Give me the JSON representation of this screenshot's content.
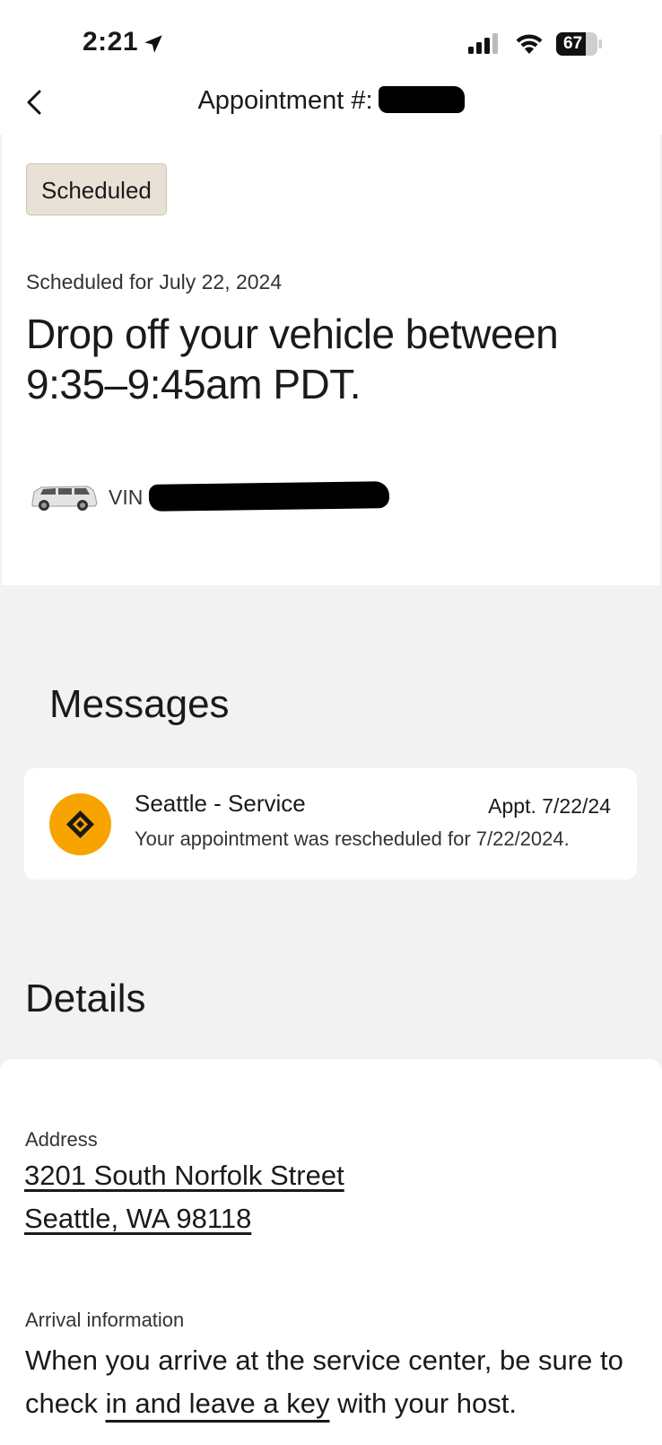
{
  "status_bar": {
    "time": "2:21",
    "battery": "67"
  },
  "nav": {
    "title": "Appointment #:"
  },
  "summary": {
    "status_badge": "Scheduled",
    "scheduled_for": "Scheduled for July 22, 2024",
    "dropoff_line1": "Drop off your vehicle between",
    "dropoff_line2": "9:35–9:45am PDT.",
    "vin_label": "VIN"
  },
  "messages": {
    "title": "Messages",
    "items": [
      {
        "from": "Seattle - Service",
        "date": "Appt. 7/22/24",
        "preview": "Your appointment was rescheduled for 7/22/2024."
      }
    ]
  },
  "details": {
    "title": "Details",
    "address_label": "Address",
    "address_line1": "3201 South Norfolk Street",
    "address_line2": "Seattle, WA 98118",
    "arrival_label": "Arrival information",
    "arrival_text_before": "When you arrive at the service center, be sure to check ",
    "arrival_text_link": "in and leave a key",
    "arrival_text_after": " with your host."
  },
  "colors": {
    "badge_bg": "#e8e2d6",
    "logo_accent": "#f7a400",
    "page_bg": "#f2f2f2"
  }
}
